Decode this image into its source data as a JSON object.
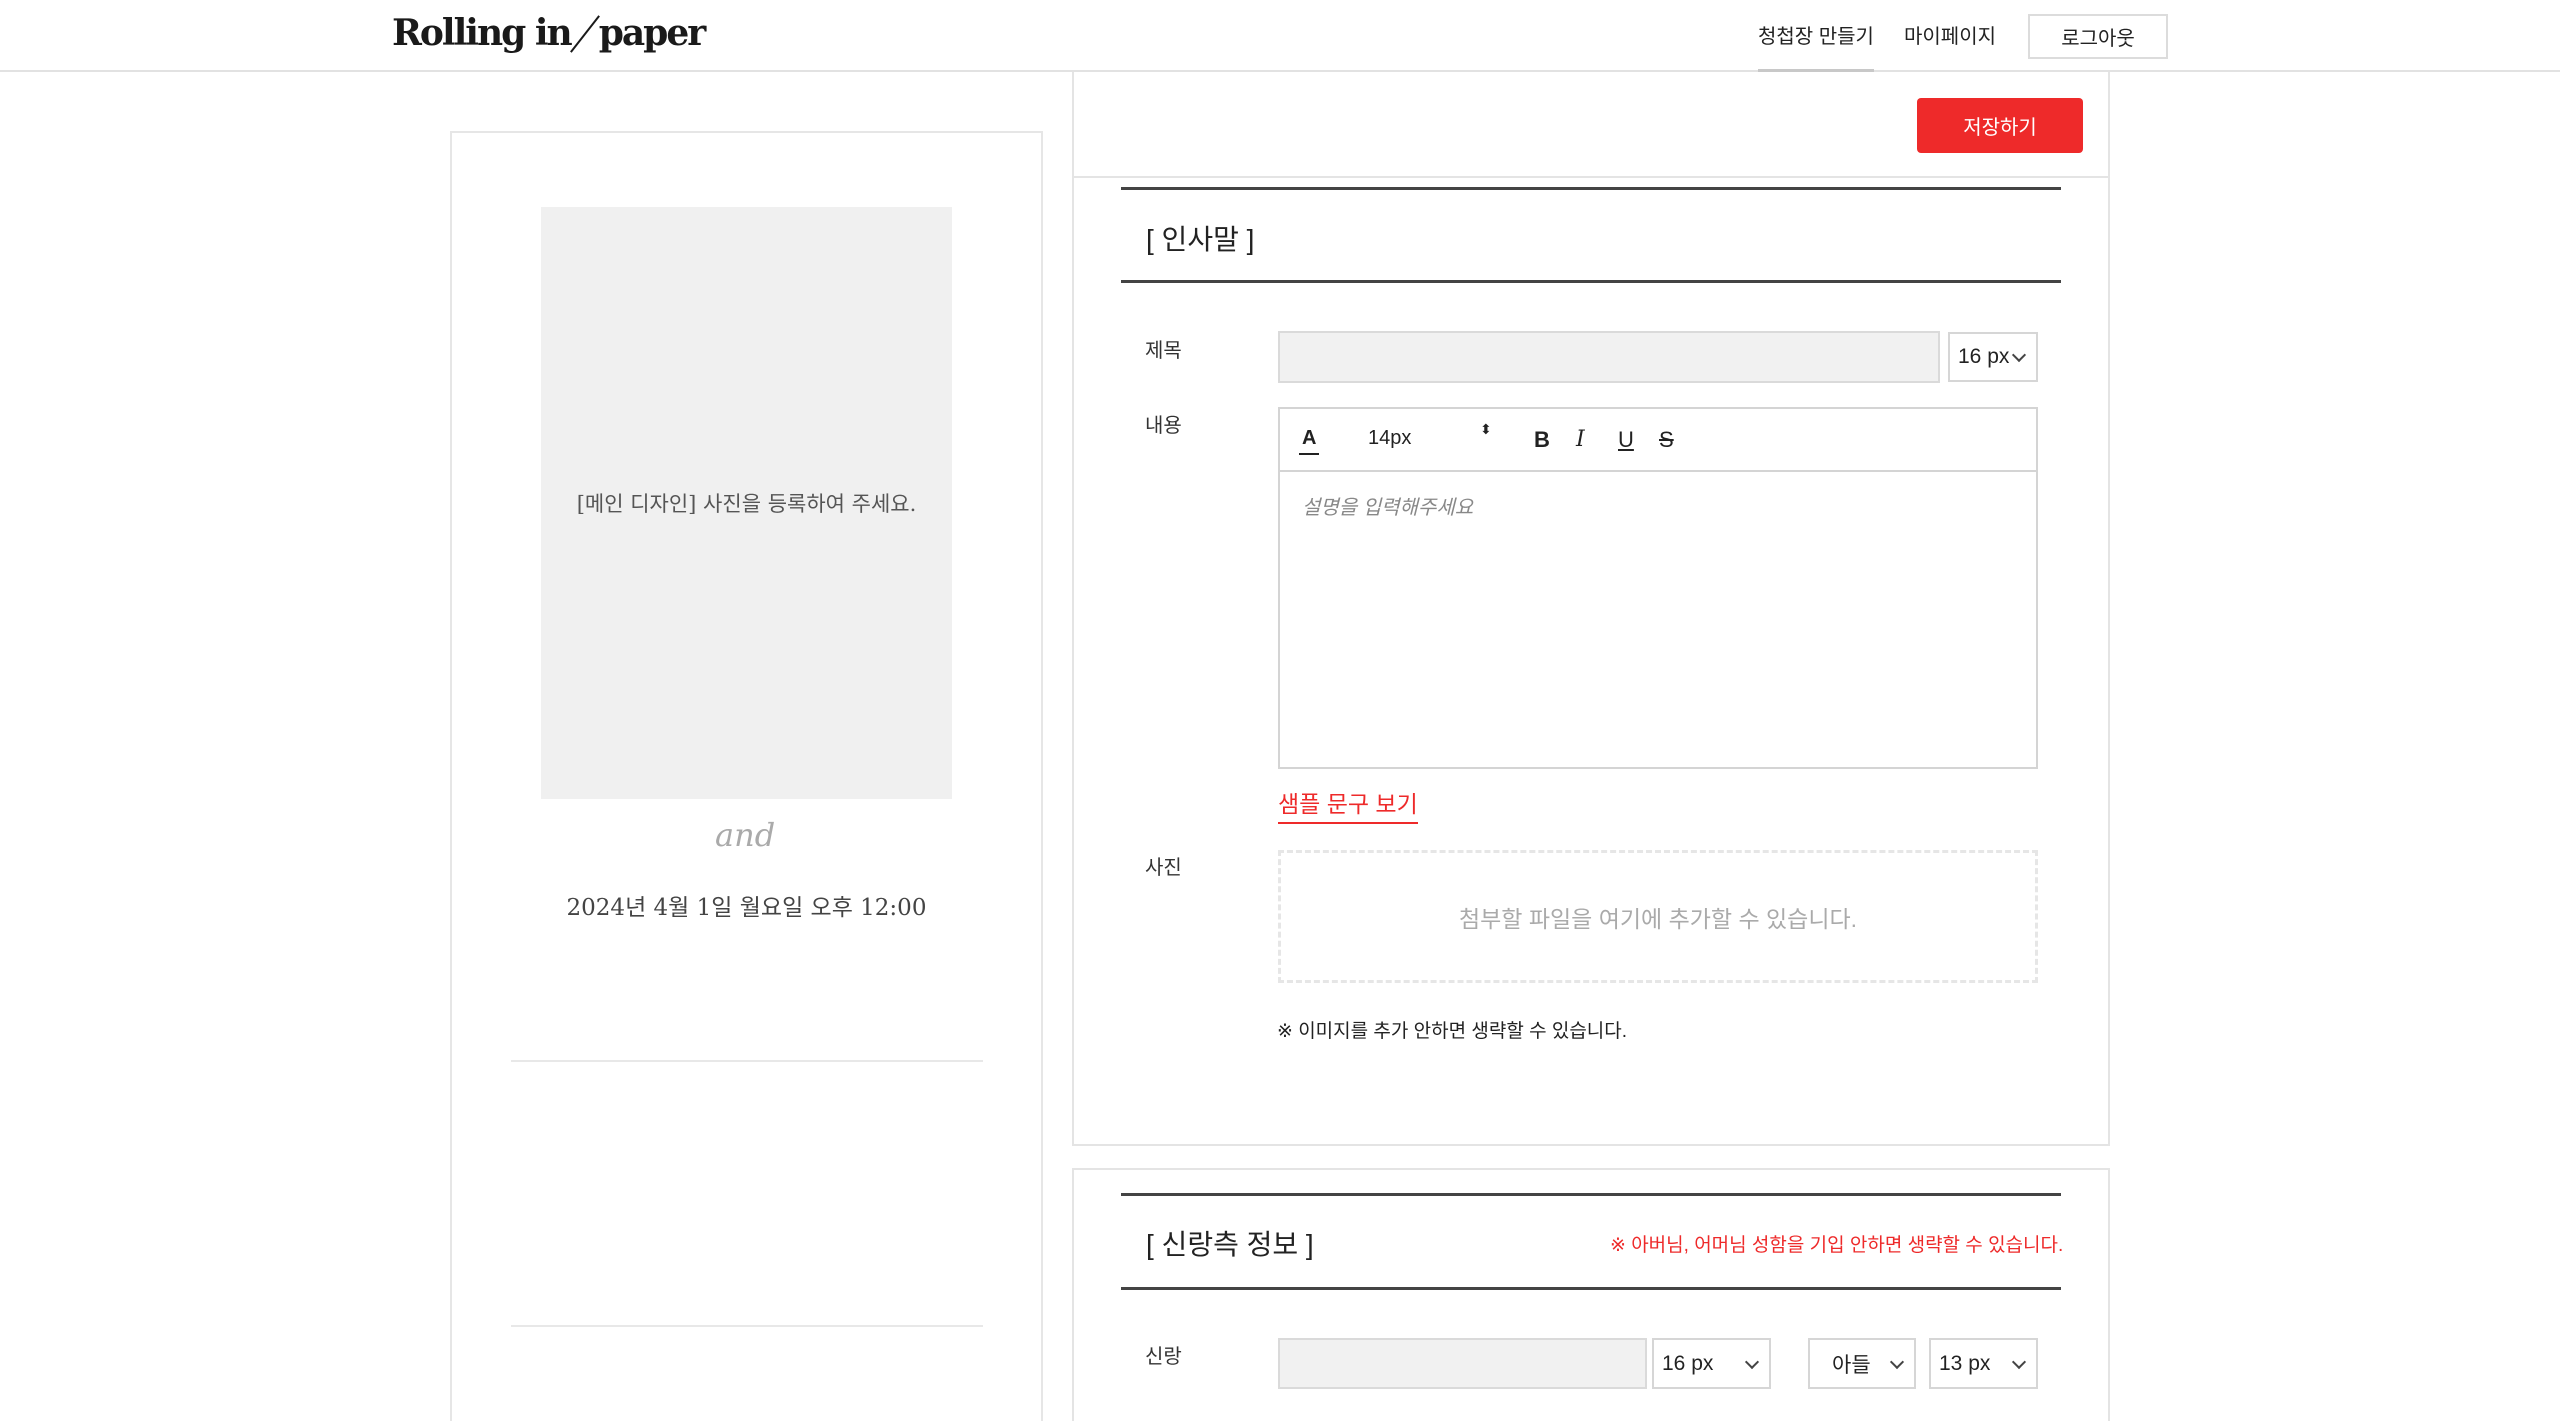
{
  "header": {
    "logo": {
      "left": "Rolling in",
      "right": "paper"
    },
    "nav": {
      "make": "청첩장 만들기",
      "mypage": "마이페이지"
    },
    "logout": "로그아웃"
  },
  "preview": {
    "photo_placeholder": "[메인 디자인] 사진을 등록하여 주세요.",
    "and": "and",
    "date": "2024년 4월 1일 월요일 오후 12:00"
  },
  "editor": {
    "save": "저장하기",
    "greeting": {
      "title": "[ 인사말 ]",
      "label_title": "제목",
      "title_value": "",
      "title_size": "16 px",
      "label_content": "내용",
      "toolbar": {
        "color": "A",
        "size": "14px",
        "size_arrows": "⬍",
        "bold": "B",
        "italic": "I",
        "underline": "U",
        "strike": "S"
      },
      "content_placeholder": "설명을 입력해주세요",
      "sample_link": "샘플 문구 보기",
      "label_photo": "사진",
      "dropzone": "첨부할 파일을 여기에 추가할 수 있습니다.",
      "note": "※ 이미지를 추가 안하면 생략할 수 있습니다."
    },
    "groom": {
      "title": "[ 신랑측 정보 ]",
      "note": "※ 아버님, 어머님 성함을 기입 안하면 생략할 수 있습니다.",
      "label_groom": "신랑",
      "name_value": "",
      "name_size": "16 px",
      "relation": "아들",
      "relation_size": "13 px"
    }
  },
  "colors": {
    "accent": "#ee2a2a",
    "input_bg": "#f1f1f1",
    "border": "#e4e4e4"
  }
}
